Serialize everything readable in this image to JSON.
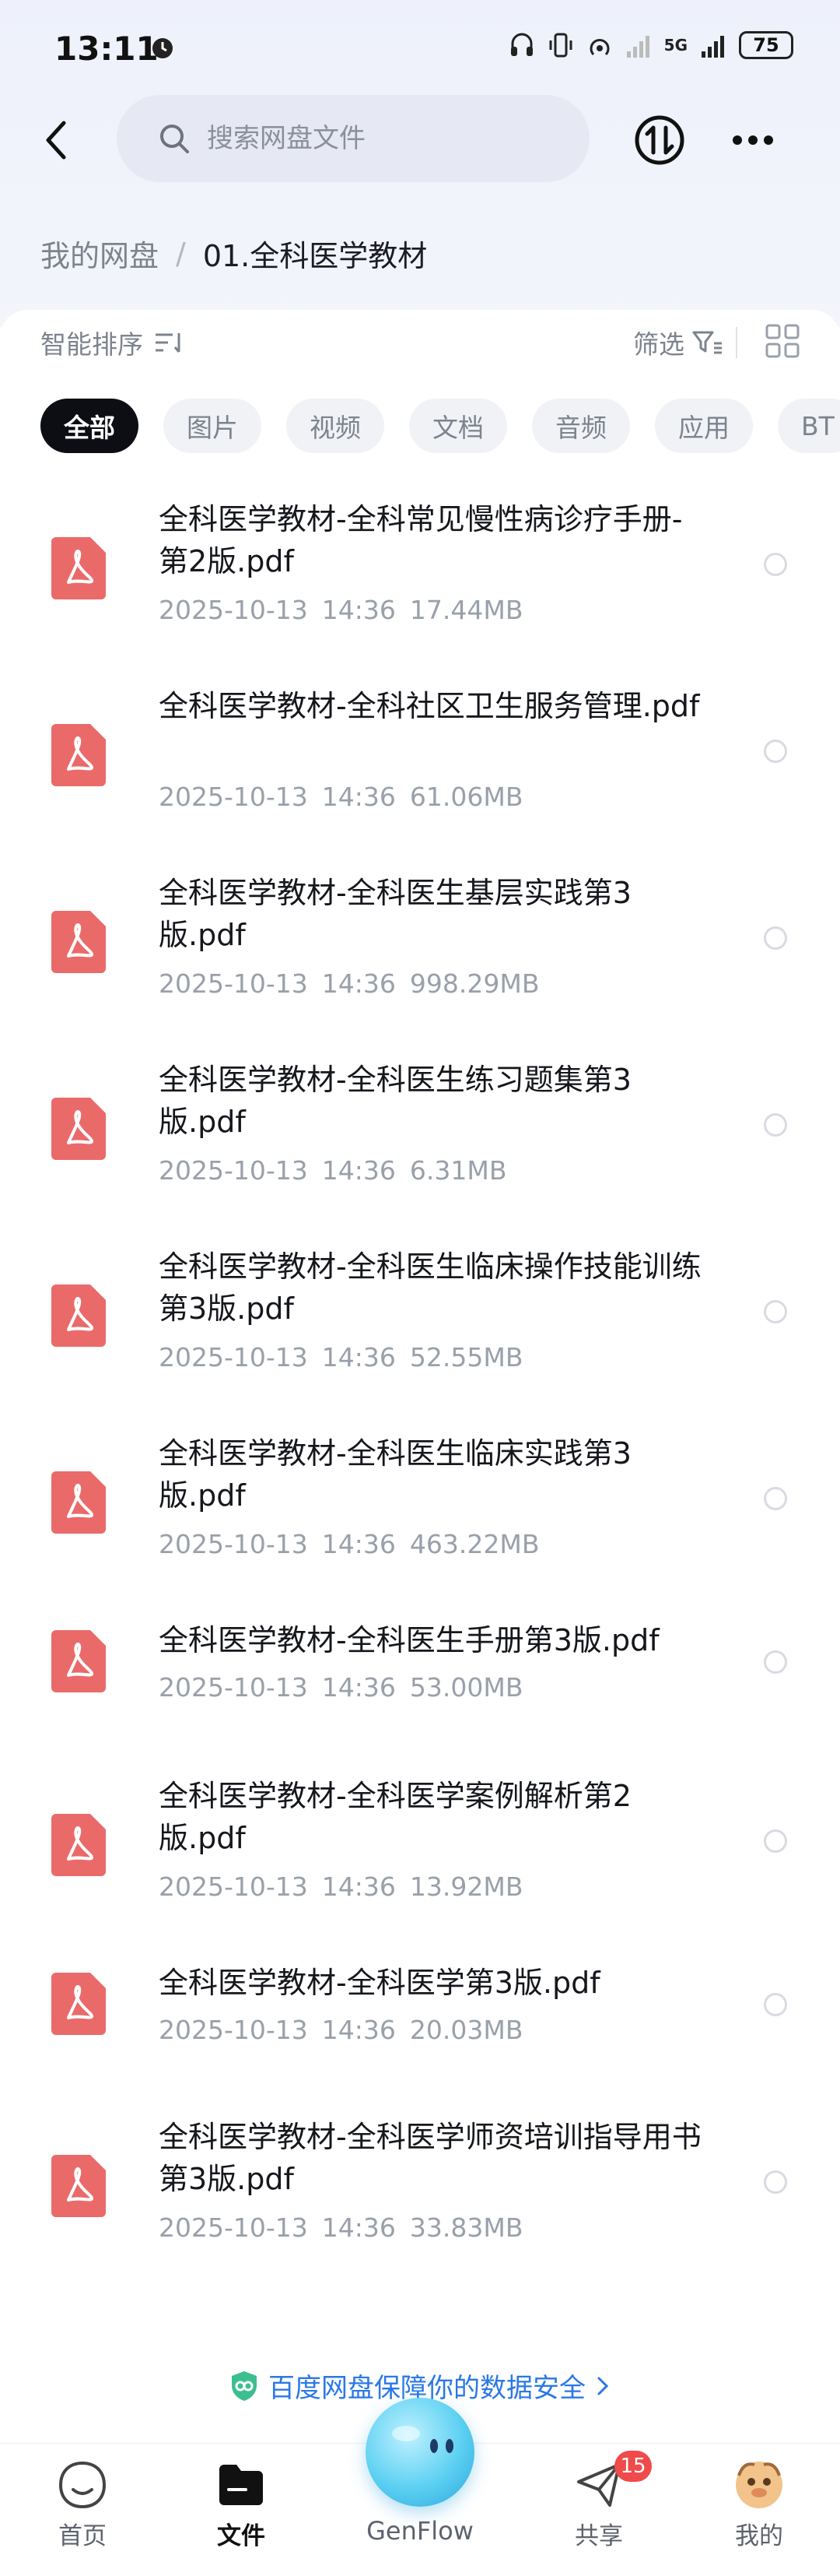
{
  "status_bar": {
    "time": "13:11",
    "network": "5G",
    "battery": "75"
  },
  "header": {
    "search_placeholder": "搜索网盘文件",
    "icons": [
      "back-arrow-icon",
      "search-icon",
      "transfer-icon",
      "more-icon"
    ]
  },
  "breadcrumb": {
    "root": "我的网盘",
    "separator": "/",
    "current": "01.全科医学教材"
  },
  "toolbar": {
    "sort_label": "智能排序",
    "filter_label": "筛选"
  },
  "filter_chips": [
    "全部",
    "图片",
    "视频",
    "文档",
    "音频",
    "应用",
    "BT"
  ],
  "files": [
    {
      "name": "全科医学教材-全科常见慢性病诊疗手册-第2版.pdf",
      "date": "2025-10-13",
      "time": "14:36",
      "size": "17.44MB"
    },
    {
      "name": "全科医学教材-全科社区卫生服务管理.pdf",
      "date": "2025-10-13",
      "time": "14:36",
      "size": "61.06MB"
    },
    {
      "name": "全科医学教材-全科医生基层实践第3版.pdf",
      "date": "2025-10-13",
      "time": "14:36",
      "size": "998.29MB"
    },
    {
      "name": "全科医学教材-全科医生练习题集第3版.pdf",
      "date": "2025-10-13",
      "time": "14:36",
      "size": "6.31MB"
    },
    {
      "name": "全科医学教材-全科医生临床操作技能训练第3版.pdf",
      "date": "2025-10-13",
      "time": "14:36",
      "size": "52.55MB"
    },
    {
      "name": "全科医学教材-全科医生临床实践第3版.pdf",
      "date": "2025-10-13",
      "time": "14:36",
      "size": "463.22MB"
    },
    {
      "name": "全科医学教材-全科医生手册第3版.pdf",
      "date": "2025-10-13",
      "time": "14:36",
      "size": "53.00MB"
    },
    {
      "name": "全科医学教材-全科医学案例解析第2版.pdf",
      "date": "2025-10-13",
      "time": "14:36",
      "size": "13.92MB"
    },
    {
      "name": "全科医学教材-全科医学第3版.pdf",
      "date": "2025-10-13",
      "time": "14:36",
      "size": "20.03MB"
    },
    {
      "name": "全科医学教材-全科医学师资培训指导用书第3版.pdf",
      "date": "2025-10-13",
      "time": "14:36",
      "size": "33.83MB"
    }
  ],
  "security_notice": "百度网盘保障你的数据安全",
  "bottom_nav": {
    "home": "首页",
    "files": "文件",
    "genflow": "GenFlow",
    "share": "共享",
    "share_badge": "15",
    "mine": "我的"
  },
  "colors": {
    "pdf_icon": "#ea6a6a",
    "accent_link": "#2b78e6",
    "active_chip": "#0c0e14"
  }
}
